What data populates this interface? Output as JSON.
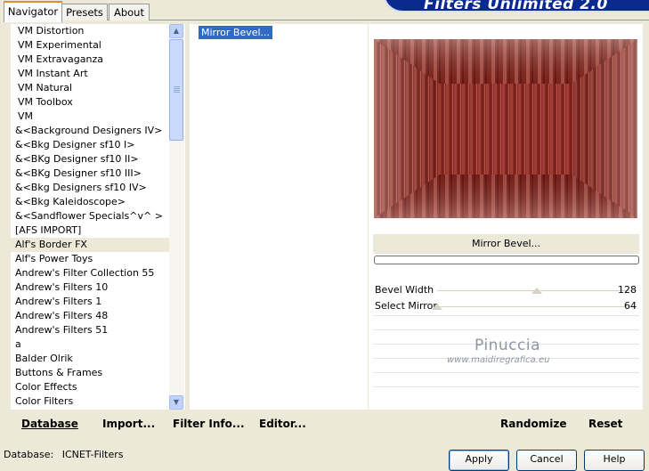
{
  "tabs": [
    "Navigator",
    "Presets",
    "About"
  ],
  "banner_title": "Filters Unlimited 2.0",
  "filter_categories": [
    "VM Distortion",
    "VM Experimental",
    "VM Extravaganza",
    "VM Instant Art",
    "VM Natural",
    "VM Toolbox",
    "VM",
    "&<Background Designers IV>",
    "&<Bkg Designer sf10 I>",
    "&<BKg Designer sf10 II>",
    "&<BKg Designer sf10 III>",
    "&<Bkg Designers sf10 IV>",
    "&<Bkg Kaleidoscope>",
    "&<Sandflower Specials^v^ >",
    "[AFS IMPORT]",
    "Alf's Border FX",
    "Alf's Power Toys",
    "Andrew's Filter Collection 55",
    "Andrew's Filters 10",
    "Andrew's Filters 1",
    "Andrew's Filters 48",
    "Andrew's Filters 51",
    "a",
    "Balder Olrik",
    "Buttons & Frames",
    "Color Effects",
    "Color Filters"
  ],
  "selected_category": "Alf's Border FX",
  "selected_filter": "Mirror Bevel...",
  "filter_name": "Mirror Bevel...",
  "params": [
    {
      "label": "Bevel Width",
      "value": "128",
      "level": 0.5
    },
    {
      "label": "Select Mirror",
      "value": "64",
      "level": 0.0
    }
  ],
  "watermark": {
    "name": "Pinuccia",
    "url": "www.maidiregrafica.eu"
  },
  "buttons": {
    "database": "Database",
    "import": "Import...",
    "filter_info": "Filter Info...",
    "editor": "Editor...",
    "randomize": "Randomize",
    "reset": "Reset"
  },
  "status": {
    "label": "Database:",
    "value": "ICNET-Filters"
  },
  "dialog_buttons": {
    "apply": "Apply",
    "cancel": "Cancel",
    "help": "Help"
  },
  "colors": {
    "accent": "#316AC5",
    "banner": "#0A2A8F",
    "preview_base": "#8B2A22",
    "tab_highlight": "#E68B2C"
  }
}
